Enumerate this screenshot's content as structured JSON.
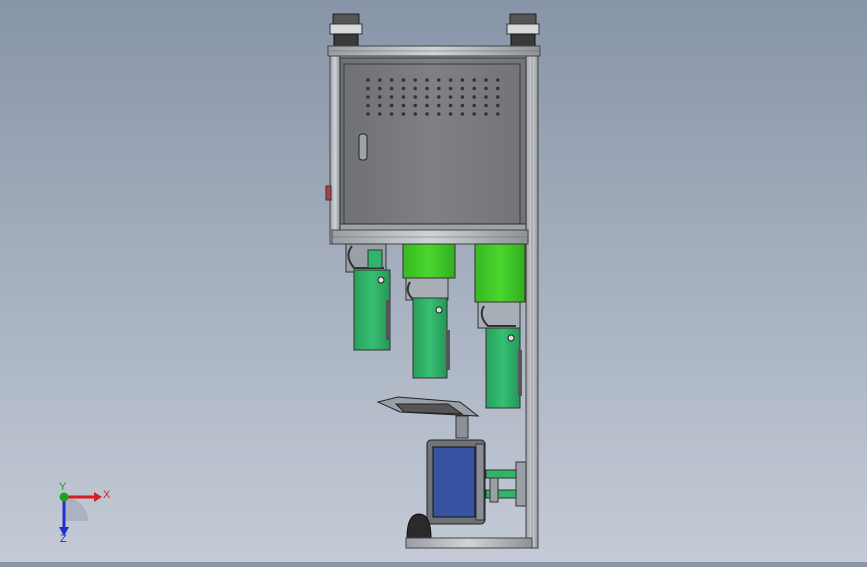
{
  "viewport": {
    "background_top": "#8895a8",
    "background_bottom": "#c4cbd6"
  },
  "triad": {
    "x_label": "X",
    "y_label": "Y",
    "z_label": "Z",
    "x_color": "#d42020",
    "y_color": "#20a020",
    "z_color": "#2030c8"
  },
  "model": {
    "frame_color": "#b8bcc2",
    "cabinet_color": "#7a7c80",
    "motor_green": "#2fb56a",
    "motor_lime": "#3fd028",
    "monitor_screen": "#3652a0",
    "dark": "#2a2a2a"
  }
}
